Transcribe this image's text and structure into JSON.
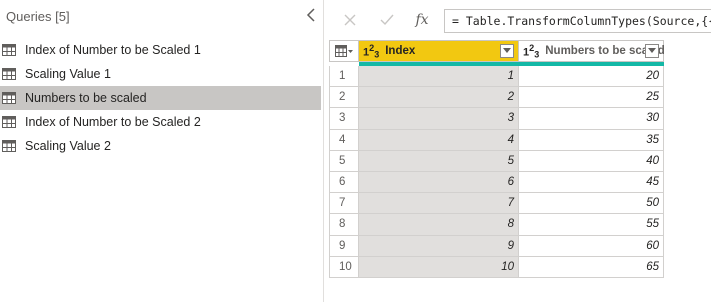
{
  "queries_pane": {
    "header": "Queries [5]",
    "items": [
      {
        "label": "Index of Number to be Scaled 1",
        "selected": false
      },
      {
        "label": "Scaling Value 1",
        "selected": false
      },
      {
        "label": "Numbers to be scaled",
        "selected": true
      },
      {
        "label": "Index of Number to be Scaled 2",
        "selected": false
      },
      {
        "label": "Scaling Value 2",
        "selected": false
      }
    ]
  },
  "formula_bar": {
    "formula": "= Table.TransformColumnTypes(Source,{{\"",
    "fx_label": "fx"
  },
  "grid": {
    "columns": [
      {
        "type_icon": "123",
        "label": "Index"
      },
      {
        "type_icon": "123",
        "label": "Numbers to be scaled"
      }
    ],
    "rows": [
      {
        "n": "1",
        "index": "1",
        "scaled": "20"
      },
      {
        "n": "2",
        "index": "2",
        "scaled": "25"
      },
      {
        "n": "3",
        "index": "3",
        "scaled": "30"
      },
      {
        "n": "4",
        "index": "4",
        "scaled": "35"
      },
      {
        "n": "5",
        "index": "5",
        "scaled": "40"
      },
      {
        "n": "6",
        "index": "6",
        "scaled": "45"
      },
      {
        "n": "7",
        "index": "7",
        "scaled": "50"
      },
      {
        "n": "8",
        "index": "8",
        "scaled": "55"
      },
      {
        "n": "9",
        "index": "9",
        "scaled": "60"
      },
      {
        "n": "10",
        "index": "10",
        "scaled": "65"
      }
    ]
  },
  "colors": {
    "selected_column": "#f2c811",
    "selected_query": "#c8c6c4",
    "quality_bar": "#14b8a6"
  }
}
